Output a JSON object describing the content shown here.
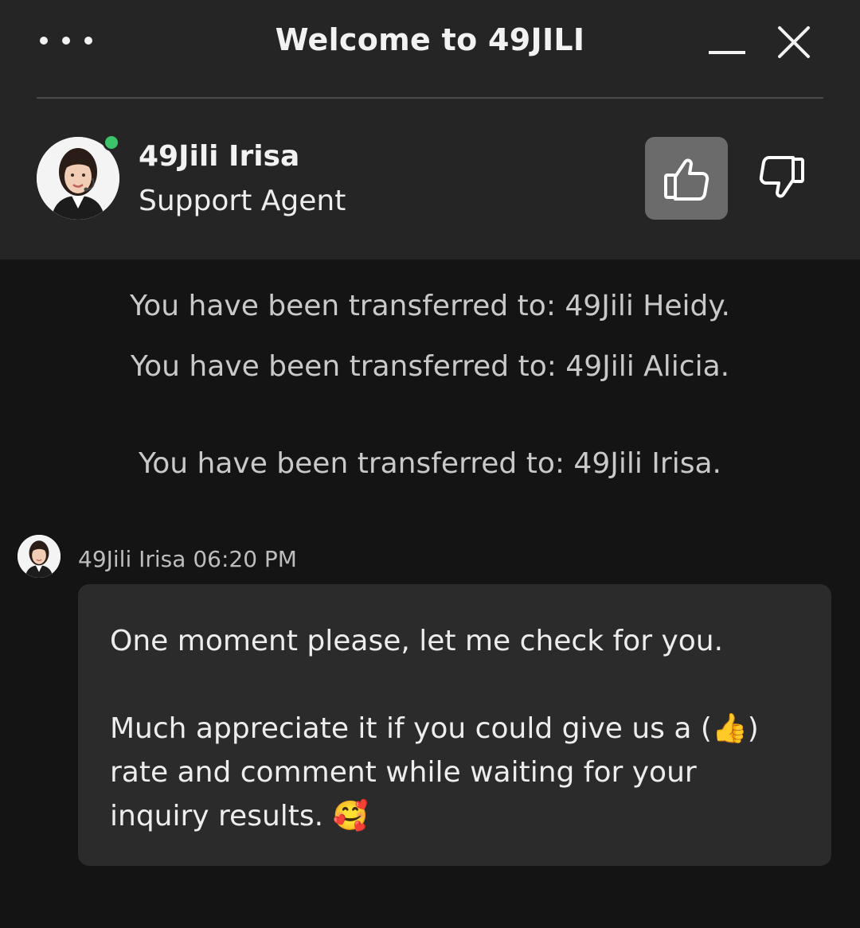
{
  "window": {
    "title": "Welcome to 49JILI",
    "menu_icon": "more-horizontal-icon",
    "minimize_icon": "minimize-icon",
    "close_icon": "close-icon"
  },
  "agent": {
    "name": "49Jili Irisa",
    "role": "Support Agent",
    "status": "online",
    "status_color": "#3cc46a",
    "rate_up_icon": "thumbs-up-icon",
    "rate_down_icon": "thumbs-down-icon"
  },
  "system_messages": [
    "You have been transferred to: 49Jili Heidy.",
    "You have been transferred to: 49Jili Alicia.",
    "You have been transferred to: 49Jili Irisa."
  ],
  "message": {
    "sender": "49Jili Irisa",
    "time": "06:20 PM",
    "meta": "49Jili Irisa 06:20 PM",
    "line1": "One moment please, let me check for you.",
    "line2_before": "Much appreciate it if you could give us a (",
    "line2_emoji": "👍",
    "line2_after": ")",
    "line3": "rate and comment while waiting for your",
    "line4": "inquiry results. ",
    "line4_emoji": "🥰"
  }
}
